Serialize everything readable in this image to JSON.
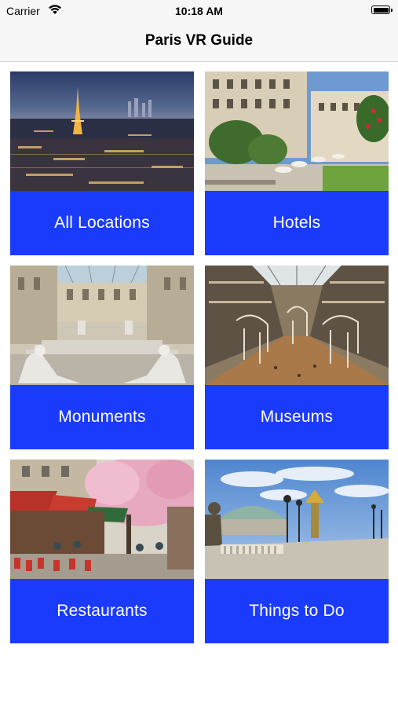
{
  "status_bar": {
    "carrier": "Carrier",
    "time": "10:18 AM",
    "wifi_icon": "wifi-icon",
    "battery_icon": "battery-icon"
  },
  "nav": {
    "title": "Paris VR Guide"
  },
  "colors": {
    "tile_accent": "#1b3bfc",
    "bar_background": "#f7f7f7"
  },
  "categories": [
    {
      "label": "All Locations",
      "image": "paris-eiffel-tower-night-photo"
    },
    {
      "label": "Hotels",
      "image": "hotel-courtyard-photo"
    },
    {
      "label": "Monuments",
      "image": "louvre-sculpture-court-photo"
    },
    {
      "label": "Museums",
      "image": "natural-history-gallery-photo"
    },
    {
      "label": "Restaurants",
      "image": "cafe-terrace-cherry-blossom-photo"
    },
    {
      "label": "Things to Do",
      "image": "pont-alexandre-iii-photo"
    }
  ]
}
